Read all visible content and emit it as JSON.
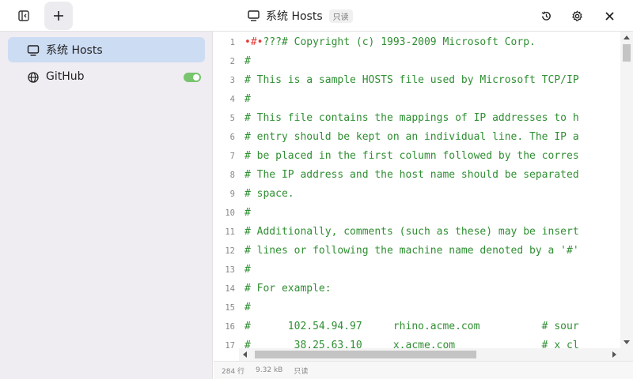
{
  "titlebar": {
    "title": "系统 Hosts",
    "badge": "只读",
    "icons": {
      "toggle": "sidebar-toggle-icon",
      "add": "plus-icon",
      "history": "history-icon",
      "settings": "gear-icon",
      "close": "close-icon",
      "title": "monitor-icon"
    }
  },
  "sidebar": {
    "items": [
      {
        "label": "系统 Hosts",
        "icon": "monitor-icon",
        "active": true
      },
      {
        "label": "GitHub",
        "icon": "globe-icon",
        "enabled": true
      }
    ]
  },
  "editor": {
    "lines": [
      {
        "n": "1",
        "text": "#???# Copyright (c) 1993-2009 Microsoft Corp."
      },
      {
        "n": "2",
        "text": "#"
      },
      {
        "n": "3",
        "text": "# This is a sample HOSTS file used by Microsoft TCP/IP"
      },
      {
        "n": "4",
        "text": "#"
      },
      {
        "n": "5",
        "text": "# This file contains the mappings of IP addresses to h"
      },
      {
        "n": "6",
        "text": "# entry should be kept on an individual line. The IP a"
      },
      {
        "n": "7",
        "text": "# be placed in the first column followed by the corres"
      },
      {
        "n": "8",
        "text": "# The IP address and the host name should be separated"
      },
      {
        "n": "9",
        "text": "# space."
      },
      {
        "n": "10",
        "text": "#"
      },
      {
        "n": "11",
        "text": "# Additionally, comments (such as these) may be insert"
      },
      {
        "n": "12",
        "text": "# lines or following the machine name denoted by a '#'"
      },
      {
        "n": "13",
        "text": "#"
      },
      {
        "n": "14",
        "text": "# For example:"
      },
      {
        "n": "15",
        "text": "#"
      },
      {
        "n": "16",
        "text": "#      102.54.94.97     rhino.acme.com          # sour"
      },
      {
        "n": "17",
        "text": "#       38.25.63.10     x.acme.com              # x cl"
      }
    ],
    "first_line_marker": "•#•"
  },
  "statusbar": {
    "lines": "284 行",
    "size": "9.32 kB",
    "mode": "只读"
  },
  "colors": {
    "accent": "#ccdcf3",
    "code": "#2f8f32",
    "toggle_on": "#79c46f",
    "marker": "#e53935"
  }
}
